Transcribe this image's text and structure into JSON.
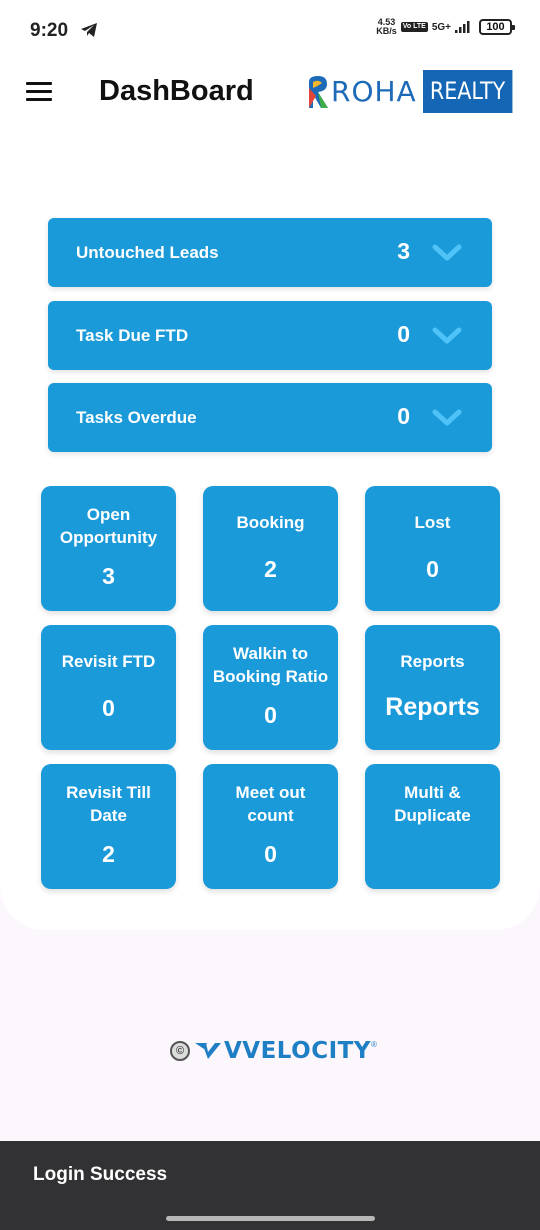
{
  "status_bar": {
    "time": "9:20",
    "net_speed_value": "4.53",
    "net_speed_unit": "KB/s",
    "volte_badge": "Vo LTE",
    "network_type": "5G+",
    "battery": "100"
  },
  "header": {
    "title": "DashBoard",
    "brand_name": "ROHA",
    "brand_tag": "REALTY",
    "menu_icon": "hamburger-menu-icon"
  },
  "summary_rows": [
    {
      "label": "Untouched Leads",
      "count": "3"
    },
    {
      "label": "Task Due FTD",
      "count": "0"
    },
    {
      "label": "Tasks Overdue",
      "count": "0"
    }
  ],
  "tiles": [
    {
      "label": "Open Opportunity",
      "value": "3"
    },
    {
      "label": "Booking",
      "value": "2"
    },
    {
      "label": "Lost",
      "value": "0"
    },
    {
      "label": "Revisit FTD",
      "value": "0"
    },
    {
      "label": "Walkin to Booking Ratio",
      "value": "0"
    },
    {
      "label": "Reports",
      "value": "Reports"
    },
    {
      "label": "Revisit Till Date",
      "value": "2"
    },
    {
      "label": "Meet out count",
      "value": "0"
    },
    {
      "label": "Multi & Duplicate",
      "value": ""
    }
  ],
  "footer": {
    "copyright": "©",
    "brand": "VVELOCITY",
    "registered": "®"
  },
  "snackbar": {
    "message": "Login Success"
  },
  "colors": {
    "accent": "#1b9ad9",
    "brand_blue": "#1567b5",
    "snackbar_bg": "#323133",
    "page_bg": "#fcf6fd"
  }
}
